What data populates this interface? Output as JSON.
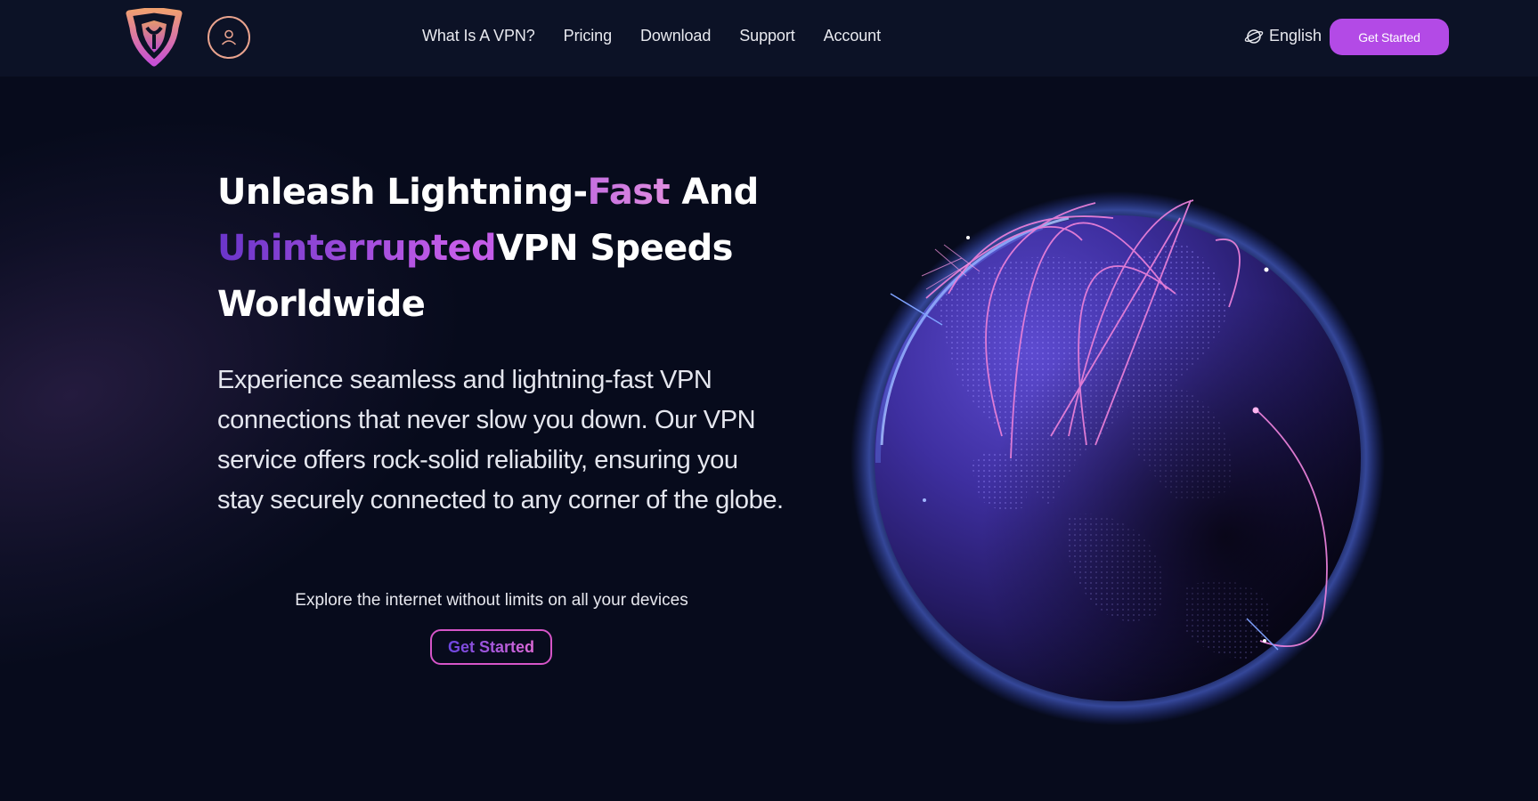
{
  "nav": {
    "links": [
      "What Is A VPN?",
      "Pricing",
      "Download",
      "Support",
      "Account"
    ],
    "language": "English",
    "cta_label": "Get Started"
  },
  "hero": {
    "title_part1": "Unleash Lightning-",
    "title_highlight1": "Fast",
    "title_part2": " And",
    "title_highlight2": "Uninterrupted",
    "title_part3": "VPN Speeds",
    "title_part4": "Worldwide",
    "description": "Experience seamless and lightning-fast VPN connections that never slow you down. Our VPN service offers rock-solid reliability, ensuring you stay securely connected to any corner of the globe.",
    "subtitle": "Explore the internet without limits on all your devices",
    "cta_label": "Get Started"
  },
  "icons": {
    "logo": "shield-logo-icon",
    "account": "user-icon",
    "language": "globe-icon",
    "hero_visual": "globe-network-illustration"
  },
  "colors": {
    "background": "#070b1c",
    "navbar": "#0c1226",
    "accent": "#b34ae6",
    "highlight_pink": "#d655c8",
    "highlight_purple": "#6a35c9"
  }
}
